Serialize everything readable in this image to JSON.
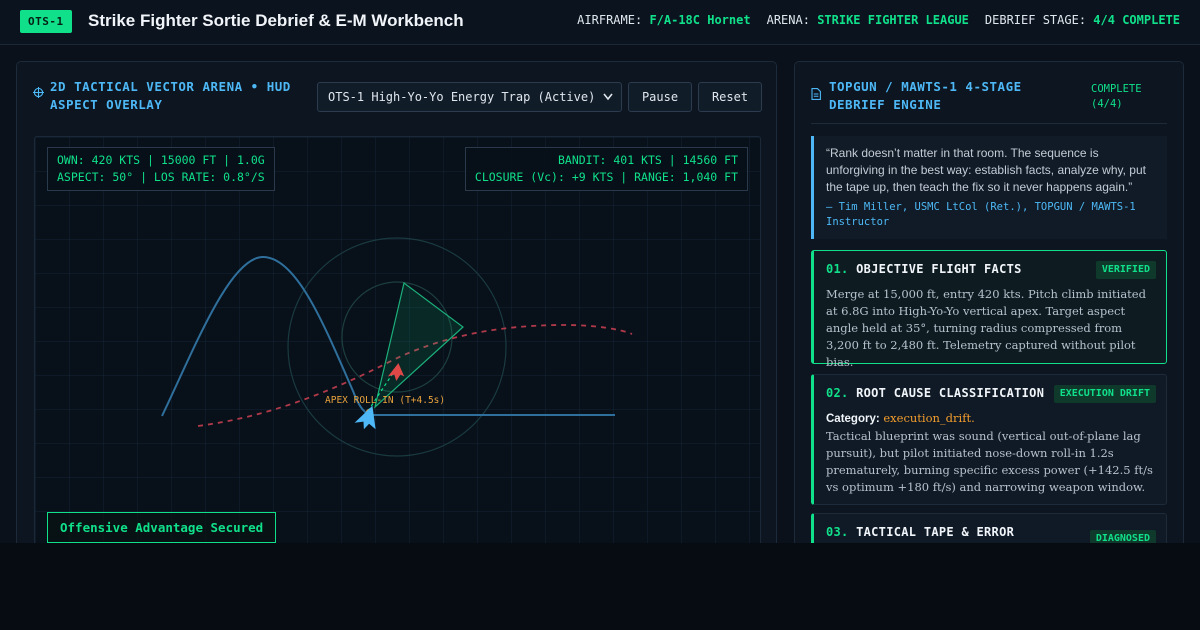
{
  "header": {
    "badge": "OTS-1",
    "title": "Strike Fighter Sortie Debrief & E-M Workbench",
    "stats": [
      {
        "label": "AIRFRAME:",
        "value": "F/A-18C Hornet"
      },
      {
        "label": "ARENA:",
        "value": "STRIKE FIGHTER LEAGUE"
      },
      {
        "label": "DEBRIEF STAGE:",
        "value": "4/4 COMPLETE"
      }
    ]
  },
  "arena_panel": {
    "title": "2D TACTICAL VECTOR ARENA • HUD ASPECT OVERLAY",
    "icon": "crosshair-icon",
    "scenario_select": "OTS-1 High-Yo-Yo Energy Trap (Active)",
    "pause_label": "Pause",
    "reset_label": "Reset",
    "hud_own": {
      "line1": "OWN: 420 KTS | 15000 FT | 1.0G",
      "line2": "ASPECT: 50° | LOS RATE: 0.8°/S"
    },
    "hud_bandit": {
      "line1": "BANDIT: 401 KTS | 14560 FT",
      "line2": "CLOSURE (Vc): +9 KTS | RANGE: 1,040 FT"
    },
    "apex_label": "APEX ROLL-IN (T+4.5s)",
    "status": "Offensive Advantage Secured",
    "colors": {
      "own_track": "#2f6f9c",
      "bandit_track": "#b03a4a",
      "weapon_cone": "#10e08a",
      "own_jet": "#4db8f5",
      "bandit_jet": "#e04848",
      "apex": "#e8a23c"
    }
  },
  "debrief_panel": {
    "title": "TOPGUN / MAWTS-1 4-STAGE DEBRIEF ENGINE",
    "icon": "document-icon",
    "status": "COMPLETE (4/4)",
    "quote": "“Rank doesn’t matter in that room. The sequence is unforgiving in the best way: establish facts, analyze why, put the tape up, then teach the fix so it never happens again.”",
    "quote_author": "— Tim Miller, USMC LtCol (Ret.), TOPGUN / MAWTS-1 Instructor",
    "steps": [
      {
        "num": "01.",
        "title": "OBJECTIVE FLIGHT FACTS",
        "badge": "VERIFIED",
        "body": "Merge at 15,000 ft, entry 420 kts. Pitch climb initiated at 6.8G into High-Yo-Yo vertical apex. Target aspect angle held at 35°, turning radius compressed from 3,200 ft to 2,480 ft. Telemetry captured without pilot bias."
      },
      {
        "num": "02.",
        "title": "ROOT CAUSE CLASSIFICATION",
        "badge": "EXECUTION DRIFT",
        "category_label": "Category:",
        "category_value": "execution_drift.",
        "body": "Tactical blueprint was sound (vertical out-of-plane lag pursuit), but pilot initiated nose-down roll-in 1.2s prematurely, burning specific excess power (+142.5 ft/s vs optimum +180 ft/s) and narrowing weapon window."
      },
      {
        "num": "03.",
        "title": "TACTICAL TAPE & ERROR EXTRACTION",
        "badge": "DIAGNOSED"
      }
    ]
  }
}
